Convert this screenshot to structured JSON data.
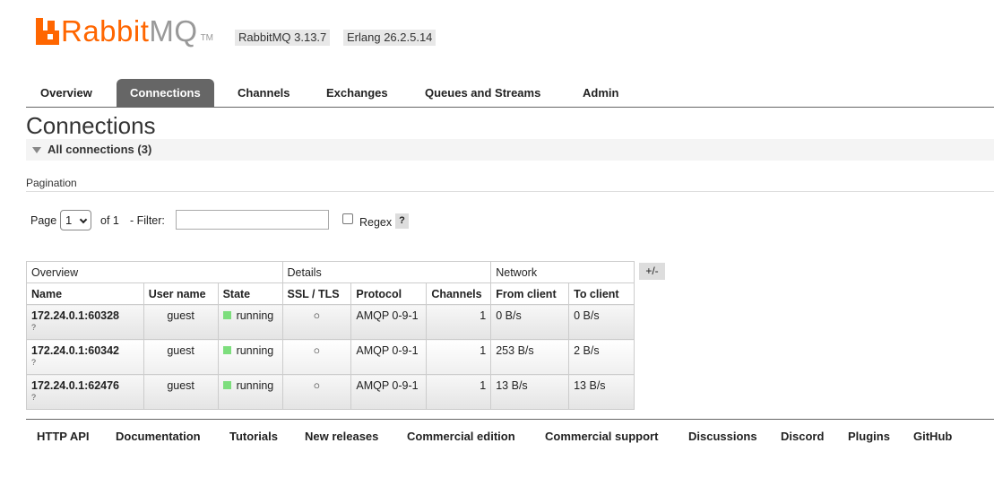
{
  "header": {
    "logo_rabbit": "Rabbit",
    "logo_mq": "MQ",
    "logo_tm": "TM",
    "version": "RabbitMQ 3.13.7",
    "erlang": "Erlang 26.2.5.14",
    "brand_color": "#ff6600"
  },
  "tabs": [
    {
      "label": "Overview"
    },
    {
      "label": "Connections",
      "active": true
    },
    {
      "label": "Channels"
    },
    {
      "label": "Exchanges"
    },
    {
      "label": "Queues and Streams"
    },
    {
      "label": "Admin"
    }
  ],
  "page": {
    "title": "Connections",
    "section": "All connections (3)"
  },
  "pagination": {
    "label": "Pagination",
    "page_label": "Page",
    "page_value": "1",
    "of_label": "of 1",
    "filter_label": "- Filter:",
    "filter_value": "",
    "regex_label": "Regex",
    "help": "?"
  },
  "table": {
    "groups": [
      "Overview",
      "Details",
      "Network"
    ],
    "columns": [
      "Name",
      "User name",
      "State",
      "SSL / TLS",
      "Protocol",
      "Channels",
      "From client",
      "To client"
    ],
    "plus_minus": "+/-",
    "rows": [
      {
        "name": "172.24.0.1:60328",
        "q": "?",
        "user": "guest",
        "state": "running",
        "ssl": "○",
        "protocol": "AMQP 0-9-1",
        "channels": "1",
        "from": "0 B/s",
        "to": "0 B/s"
      },
      {
        "name": "172.24.0.1:60342",
        "q": "?",
        "user": "guest",
        "state": "running",
        "ssl": "○",
        "protocol": "AMQP 0-9-1",
        "channels": "1",
        "from": "253 B/s",
        "to": "2 B/s"
      },
      {
        "name": "172.24.0.1:62476",
        "q": "?",
        "user": "guest",
        "state": "running",
        "ssl": "○",
        "protocol": "AMQP 0-9-1",
        "channels": "1",
        "from": "13 B/s",
        "to": "13 B/s"
      }
    ],
    "running_color": "#7dde7d"
  },
  "footer": [
    "HTTP API",
    "Documentation",
    "Tutorials",
    "New releases",
    "Commercial edition",
    "Commercial support",
    "Discussions",
    "Discord",
    "Plugins",
    "GitHub"
  ]
}
